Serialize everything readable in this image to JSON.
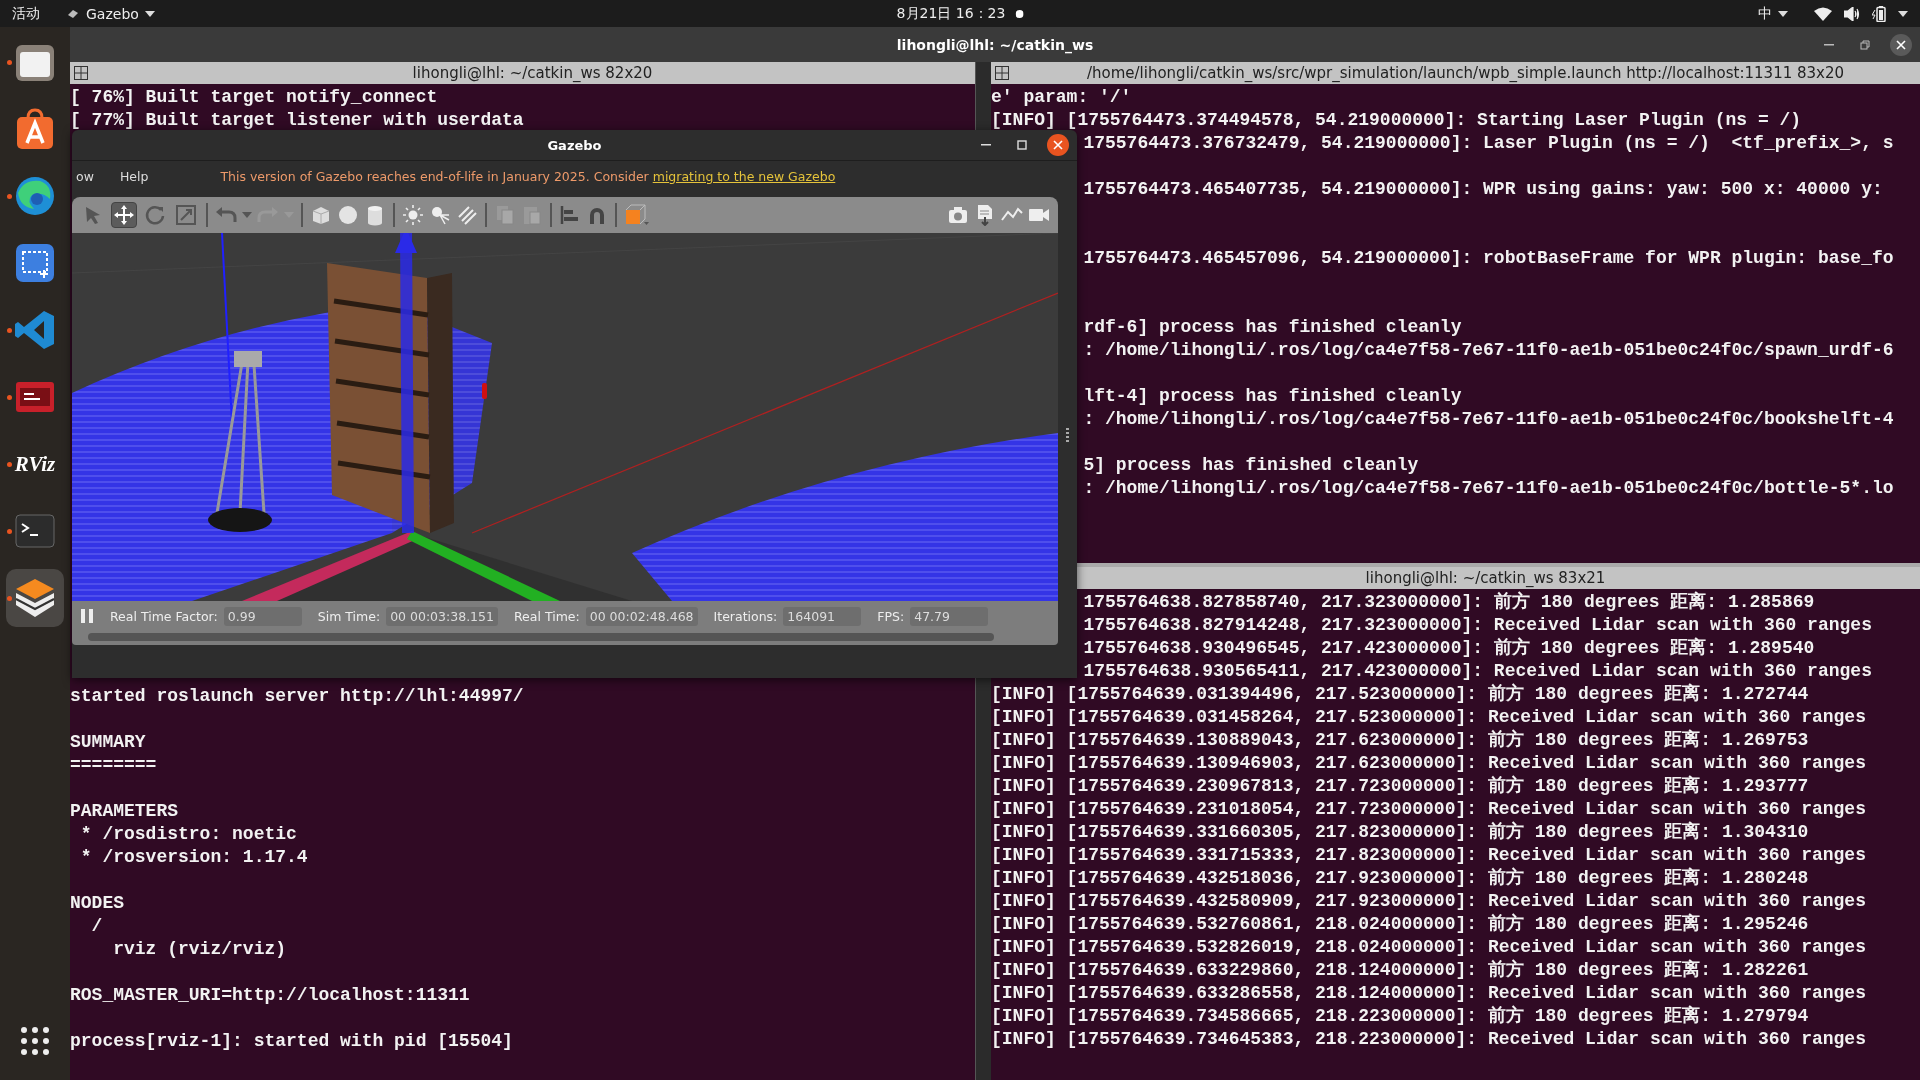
{
  "top_bar": {
    "activities": "活动",
    "app_menu": "Gazebo",
    "clock": "8月21日 16：23",
    "input_method": "中"
  },
  "dock": {
    "apps": [
      {
        "kind": "files",
        "running": true,
        "selected": false
      },
      {
        "kind": "store",
        "running": false,
        "selected": false
      },
      {
        "kind": "browser",
        "running": true,
        "selected": false
      },
      {
        "kind": "screenshot",
        "running": false,
        "selected": false
      },
      {
        "kind": "code",
        "running": true,
        "selected": false
      },
      {
        "kind": "red-app",
        "running": true,
        "selected": false
      },
      {
        "kind": "rviz",
        "label": "RViz",
        "running": true,
        "selected": false
      },
      {
        "kind": "terminal",
        "running": true,
        "selected": false
      },
      {
        "kind": "gazebo",
        "running": true,
        "selected": true
      }
    ]
  },
  "terminal_window": {
    "title": "lihongli@lhl: ~/catkin_ws",
    "left_pane": {
      "title": "lihongli@lhl: ~/catkin_ws 82x20",
      "lines_top": [
        {
          "kind": "full",
          "text": "[ 76%] Built target notify_connect"
        },
        {
          "kind": "full",
          "text": "[ 77%] Built target listener with userdata"
        }
      ],
      "lines_bottom": [
        {
          "kind": "full",
          "text": "started roslaunch server http://lhl:44997/"
        },
        {
          "kind": "blank"
        },
        {
          "kind": "full",
          "text": "SUMMARY"
        },
        {
          "kind": "full",
          "text": "========"
        },
        {
          "kind": "blank"
        },
        {
          "kind": "full",
          "text": "PARAMETERS"
        },
        {
          "kind": "full",
          "text": " * /rosdistro: noetic"
        },
        {
          "kind": "full",
          "text": " * /rosversion: 1.17.4"
        },
        {
          "kind": "blank"
        },
        {
          "kind": "full",
          "text": "NODES"
        },
        {
          "kind": "full",
          "text": "  /"
        },
        {
          "kind": "full",
          "text": "    rviz (rviz/rviz)"
        },
        {
          "kind": "blank"
        },
        {
          "kind": "full",
          "text": "ROS_MASTER_URI=http://localhost:11311"
        },
        {
          "kind": "blank"
        },
        {
          "kind": "full",
          "text": "process[rviz-1]: started with pid [15504]"
        },
        {
          "kind": "blank"
        }
      ]
    },
    "right_top_pane": {
      "title": "/home/lihongli/catkin_ws/src/wpr_simulation/launch/wpb_simple.launch http://localhost:11311 83x20",
      "lines": [
        {
          "kind": "full",
          "text": "e' param: '/'"
        },
        {
          "kind": "full",
          "text": "[INFO] [1755764473.374494578, 54.219000000]: Starting Laser Plugin (ns = /)"
        },
        {
          "kind": "clipped",
          "text": "1755764473.376732479, 54.219000000]: Laser Plugin (ns = /)  <tf_prefix_>, s"
        },
        {
          "kind": "blank"
        },
        {
          "kind": "clipped",
          "text": "1755764473.465407735, 54.219000000]: WPR using gains: yaw: 500 x: 40000 y:"
        },
        {
          "kind": "blank"
        },
        {
          "kind": "blank"
        },
        {
          "kind": "clipped",
          "text": "1755764473.465457096, 54.219000000]: robotBaseFrame for WPR plugin: base_fo"
        },
        {
          "kind": "blank"
        },
        {
          "kind": "blank"
        },
        {
          "kind": "clipped",
          "text": "rdf-6] process has finished cleanly"
        },
        {
          "kind": "clipped",
          "text": ": /home/lihongli/.ros/log/ca4e7f58-7e67-11f0-ae1b-051be0c24f0c/spawn_urdf-6"
        },
        {
          "kind": "blank"
        },
        {
          "kind": "clipped",
          "text": "lft-4] process has finished cleanly"
        },
        {
          "kind": "clipped",
          "text": ": /home/lihongli/.ros/log/ca4e7f58-7e67-11f0-ae1b-051be0c24f0c/bookshelft-4"
        },
        {
          "kind": "blank"
        },
        {
          "kind": "clipped",
          "text": "5] process has finished cleanly"
        },
        {
          "kind": "clipped",
          "text": ": /home/lihongli/.ros/log/ca4e7f58-7e67-11f0-ae1b-051be0c24f0c/bottle-5*.lo"
        }
      ]
    },
    "right_bottom_pane": {
      "title": "lihongli@lhl: ~/catkin_ws 83x21",
      "lines": [
        {
          "kind": "clipped",
          "text": "1755764638.827858740, 217.323000000]: 前方 180 degrees 距离: 1.285869"
        },
        {
          "kind": "clipped",
          "text": "1755764638.827914248, 217.323000000]: Received Lidar scan with 360 ranges"
        },
        {
          "kind": "clipped",
          "text": "1755764638.930496545, 217.423000000]: 前方 180 degrees 距离: 1.289540"
        },
        {
          "kind": "clipped",
          "text": "1755764638.930565411, 217.423000000]: Received Lidar scan with 360 ranges"
        },
        {
          "kind": "full",
          "text": "[INFO] [1755764639.031394496, 217.523000000]: 前方 180 degrees 距离: 1.272744"
        },
        {
          "kind": "full",
          "text": "[INFO] [1755764639.031458264, 217.523000000]: Received Lidar scan with 360 ranges"
        },
        {
          "kind": "full",
          "text": "[INFO] [1755764639.130889043, 217.623000000]: 前方 180 degrees 距离: 1.269753"
        },
        {
          "kind": "full",
          "text": "[INFO] [1755764639.130946903, 217.623000000]: Received Lidar scan with 360 ranges"
        },
        {
          "kind": "full",
          "text": "[INFO] [1755764639.230967813, 217.723000000]: 前方 180 degrees 距离: 1.293777"
        },
        {
          "kind": "full",
          "text": "[INFO] [1755764639.231018054, 217.723000000]: Received Lidar scan with 360 ranges"
        },
        {
          "kind": "full",
          "text": "[INFO] [1755764639.331660305, 217.823000000]: 前方 180 degrees 距离: 1.304310"
        },
        {
          "kind": "full",
          "text": "[INFO] [1755764639.331715333, 217.823000000]: Received Lidar scan with 360 ranges"
        },
        {
          "kind": "full",
          "text": "[INFO] [1755764639.432518036, 217.923000000]: 前方 180 degrees 距离: 1.280248"
        },
        {
          "kind": "full",
          "text": "[INFO] [1755764639.432580909, 217.923000000]: Received Lidar scan with 360 ranges"
        },
        {
          "kind": "full",
          "text": "[INFO] [1755764639.532760861, 218.024000000]: 前方 180 degrees 距离: 1.295246"
        },
        {
          "kind": "full",
          "text": "[INFO] [1755764639.532826019, 218.024000000]: Received Lidar scan with 360 ranges"
        },
        {
          "kind": "full",
          "text": "[INFO] [1755764639.633229860, 218.124000000]: 前方 180 degrees 距离: 1.282261"
        },
        {
          "kind": "full",
          "text": "[INFO] [1755764639.633286558, 218.124000000]: Received Lidar scan with 360 ranges"
        },
        {
          "kind": "full",
          "text": "[INFO] [1755764639.734586665, 218.223000000]: 前方 180 degrees 距离: 1.279794"
        },
        {
          "kind": "full",
          "text": "[INFO] [1755764639.734645383, 218.223000000]: Received Lidar scan with 360 ranges"
        }
      ]
    }
  },
  "gazebo": {
    "title": "Gazebo",
    "menus": [
      "ow",
      "Help"
    ],
    "notice": "This version of Gazebo reaches end-of-life in January 2025. Consider ",
    "notice_link": "migrating to the new Gazebo",
    "tools": [
      {
        "kind": "select",
        "selected": false
      },
      {
        "kind": "translate",
        "selected": true
      },
      {
        "kind": "rotate",
        "selected": false
      },
      {
        "kind": "scale",
        "selected": false
      }
    ],
    "stats": [
      {
        "label": "Real Time Factor:",
        "value": "0.99"
      },
      {
        "label": "Sim Time:",
        "value": "00 00:03:38.151"
      },
      {
        "label": "Real Time:",
        "value": "00 00:02:48.468"
      },
      {
        "label": "Iterations:",
        "value": "164091"
      },
      {
        "label": "FPS:",
        "value": "47.79"
      }
    ]
  }
}
